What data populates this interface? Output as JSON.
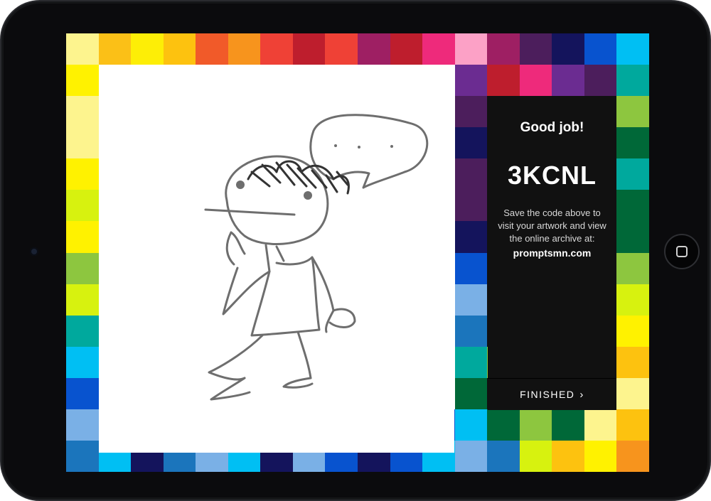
{
  "panel": {
    "title": "Good job!",
    "code": "3KCNL",
    "message": "Save the code above to visit your artwork and view the online archive at:",
    "site": "promptsmn.com"
  },
  "finished_button": {
    "label": "FINISHED",
    "arrow": "›"
  },
  "icons": {
    "finished_arrow": "chevron-right-icon",
    "home_button": "home-button-icon",
    "camera": "camera-icon"
  },
  "palette": {
    "mosaic_rows": [
      [
        "#fdf48e",
        "#fbc017",
        "#fdee06",
        "#fdc20f",
        "#f15a29",
        "#f7941d",
        "#ef4136",
        "#be1e2d",
        "#ef4136",
        "#9e1f63",
        "#be1e2d",
        "#ee2a7b",
        "#fca1c6",
        "#9e1f63",
        "#4c1e5c",
        "#14145c",
        "#0853cf",
        "#00bff3"
      ],
      [
        "#fff200",
        "#ffffff",
        "#ffffff",
        "#ffffff",
        "#ffffff",
        "#ffffff",
        "#ffffff",
        "#ffffff",
        "#ffffff",
        "#ffffff",
        "#ffffff",
        "#ffffff",
        "#6b2c91",
        "#be1e2d",
        "#ee2a7b",
        "#6b2c91",
        "#4c1e5c",
        "#00a99d"
      ],
      [
        "#fdf48e",
        "#ffffff",
        "#ffffff",
        "#ffffff",
        "#ffffff",
        "#ffffff",
        "#ffffff",
        "#ffffff",
        "#ffffff",
        "#ffffff",
        "#ffffff",
        "#ffffff",
        "#4c1e5c",
        "#111111",
        "#111111",
        "#111111",
        "#111111",
        "#8dc63f"
      ],
      [
        "#fdf48e",
        "#ffffff",
        "#ffffff",
        "#ffffff",
        "#ffffff",
        "#ffffff",
        "#ffffff",
        "#ffffff",
        "#ffffff",
        "#ffffff",
        "#ffffff",
        "#ffffff",
        "#14145c",
        "#111111",
        "#111111",
        "#111111",
        "#111111",
        "#006838"
      ],
      [
        "#fff200",
        "#ffffff",
        "#ffffff",
        "#ffffff",
        "#ffffff",
        "#ffffff",
        "#ffffff",
        "#ffffff",
        "#ffffff",
        "#ffffff",
        "#ffffff",
        "#ffffff",
        "#4c1e5c",
        "#111111",
        "#111111",
        "#111111",
        "#111111",
        "#00a99d"
      ],
      [
        "#d7f20f",
        "#ffffff",
        "#ffffff",
        "#ffffff",
        "#ffffff",
        "#ffffff",
        "#ffffff",
        "#ffffff",
        "#ffffff",
        "#ffffff",
        "#ffffff",
        "#ffffff",
        "#4c1e5c",
        "#111111",
        "#111111",
        "#111111",
        "#111111",
        "#006838"
      ],
      [
        "#fff200",
        "#ffffff",
        "#ffffff",
        "#ffffff",
        "#ffffff",
        "#ffffff",
        "#ffffff",
        "#ffffff",
        "#ffffff",
        "#ffffff",
        "#ffffff",
        "#ffffff",
        "#14145c",
        "#111111",
        "#111111",
        "#111111",
        "#111111",
        "#006838"
      ],
      [
        "#8dc63f",
        "#ffffff",
        "#ffffff",
        "#ffffff",
        "#ffffff",
        "#ffffff",
        "#ffffff",
        "#ffffff",
        "#ffffff",
        "#ffffff",
        "#ffffff",
        "#ffffff",
        "#0853cf",
        "#111111",
        "#111111",
        "#111111",
        "#111111",
        "#8dc63f"
      ],
      [
        "#d7f20f",
        "#ffffff",
        "#ffffff",
        "#ffffff",
        "#ffffff",
        "#ffffff",
        "#ffffff",
        "#ffffff",
        "#ffffff",
        "#ffffff",
        "#ffffff",
        "#ffffff",
        "#7ab0e6",
        "#111111",
        "#111111",
        "#111111",
        "#111111",
        "#d7f20f"
      ],
      [
        "#00a99d",
        "#ffffff",
        "#ffffff",
        "#ffffff",
        "#ffffff",
        "#ffffff",
        "#ffffff",
        "#ffffff",
        "#ffffff",
        "#ffffff",
        "#ffffff",
        "#ffffff",
        "#1b75bc",
        "#111111",
        "#111111",
        "#111111",
        "#111111",
        "#fff200"
      ],
      [
        "#00bff3",
        "#ffffff",
        "#ffffff",
        "#ffffff",
        "#ffffff",
        "#ffffff",
        "#ffffff",
        "#ffffff",
        "#ffffff",
        "#ffffff",
        "#ffffff",
        "#ffffff",
        "#00a99d",
        "#8dc63f",
        "#d7f20f",
        "#006838",
        "#8dc63f",
        "#fdc20f"
      ],
      [
        "#0853cf",
        "#ffffff",
        "#ffffff",
        "#ffffff",
        "#ffffff",
        "#ffffff",
        "#ffffff",
        "#ffffff",
        "#ffffff",
        "#ffffff",
        "#ffffff",
        "#ffffff",
        "#006838",
        "#111111",
        "#111111",
        "#111111",
        "#111111",
        "#fdf48e"
      ],
      [
        "#7ab0e6",
        "#0853cf",
        "#7ab0e6",
        "#14145c",
        "#00bff3",
        "#1b75bc",
        "#0853cf",
        "#1b75bc",
        "#00bff3",
        "#7ab0e6",
        "#00bff3",
        "#0853cf",
        "#00bff3",
        "#006838",
        "#8dc63f",
        "#006838",
        "#fdf48e",
        "#fdc20f"
      ],
      [
        "#1b75bc",
        "#00bff3",
        "#14145c",
        "#1b75bc",
        "#7ab0e6",
        "#00bff3",
        "#14145c",
        "#7ab0e6",
        "#0853cf",
        "#14145c",
        "#0853cf",
        "#00bff3",
        "#7ab0e6",
        "#1b75bc",
        "#d7f20f",
        "#fdc20f",
        "#fff200",
        "#f7941d"
      ]
    ]
  }
}
